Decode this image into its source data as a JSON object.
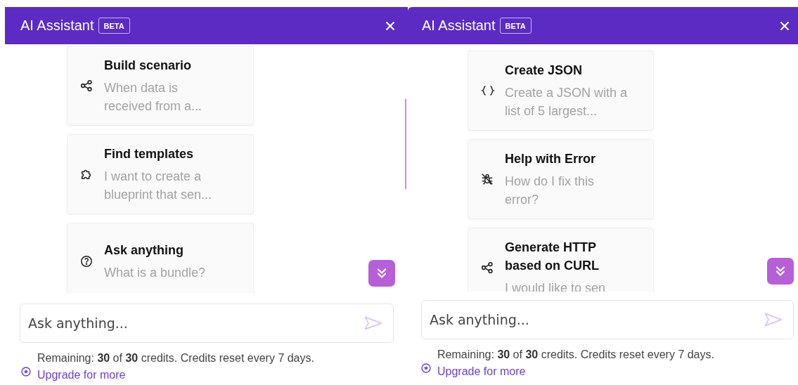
{
  "panels": [
    {
      "header": {
        "title": "AI Assistant",
        "badge": "BETA"
      },
      "scrollbar": true,
      "cards": [
        {
          "kind": "nodes",
          "title": "Build scenario",
          "description": "When data is received from a..."
        },
        {
          "kind": "puzzle",
          "title": "Find templates",
          "description": "I want to create a blueprint that sen..."
        },
        {
          "kind": "question",
          "title": "Ask anything",
          "description": "What is a bundle?"
        }
      ],
      "input": {
        "placeholder": "Ask anything..."
      },
      "footer": {
        "text": "Remaining: **30** of **30** credits. Credits reset every 7 days.",
        "link": "Upgrade for more"
      }
    },
    {
      "header": {
        "title": "AI Assistant",
        "badge": "BETA"
      },
      "scrollbar": false,
      "cards": [
        {
          "kind": "braces",
          "title": "Create JSON",
          "description": "Create a JSON with a list of 5 largest..."
        },
        {
          "kind": "bug",
          "title": "Help with Error",
          "description": "How do I fix this error?"
        },
        {
          "kind": "nodes",
          "title": "Generate HTTP based on CURL",
          "description": "I would like to sen"
        }
      ],
      "input": {
        "placeholder": "Ask anything..."
      },
      "footer": {
        "text": "Remaining: **30** of **30** credits. Credits reset every 7 days.",
        "link": "Upgrade for more"
      }
    }
  ]
}
